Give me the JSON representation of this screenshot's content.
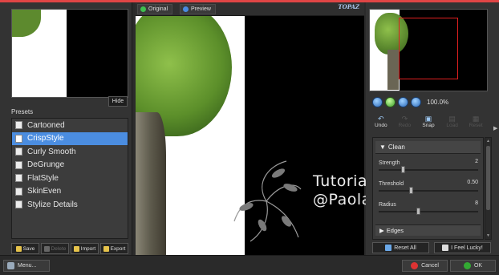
{
  "presets": {
    "label": "Presets",
    "items": [
      "Cartooned",
      "CrispStyle",
      "Curly Smooth",
      "DeGrunge",
      "FlatStyle",
      "SkinEven",
      "Stylize Details"
    ],
    "selected_index": 1
  },
  "thumbnail": {
    "hide_label": "Hide"
  },
  "preset_buttons": {
    "save": "Save",
    "delete": "Delete",
    "import": "Import",
    "export": "Export"
  },
  "preview_tabs": {
    "original": "Original",
    "preview": "Preview"
  },
  "brand": {
    "logo_text": "TOPAZ"
  },
  "watermark": {
    "line1": "Tutorial",
    "line2": "@Paolapaola"
  },
  "zoom": {
    "level": "100.0%"
  },
  "toolbar": {
    "undo": "Undo",
    "redo": "Redo",
    "snap": "Snap",
    "load": "Load",
    "reset": "Reset"
  },
  "settings": {
    "clean_section": "Clean",
    "strength": {
      "label": "Strength",
      "value": "2",
      "fraction": 0.25
    },
    "threshold": {
      "label": "Threshold",
      "value": "0.50",
      "fraction": 0.33
    },
    "radius": {
      "label": "Radius",
      "value": "8",
      "fraction": 0.4
    },
    "edges_section": "Edges"
  },
  "actions": {
    "reset_all": "Reset All",
    "lucky": "I Feel Lucky!"
  },
  "bottom": {
    "menu": "Menu...",
    "cancel": "Cancel",
    "ok": "OK"
  },
  "colors": {
    "accent_red": "#e04545",
    "selection_blue": "#4b8de0",
    "nav_rect": "#e02020"
  }
}
